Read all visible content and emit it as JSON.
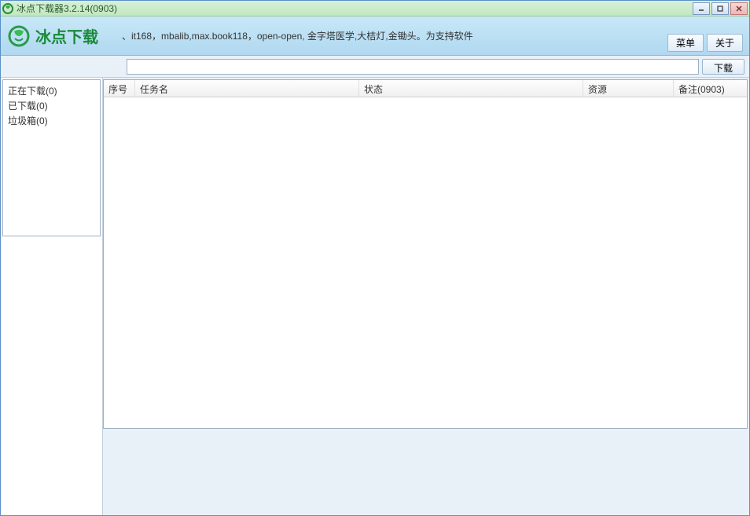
{
  "window": {
    "title": "冰点下载器3.2.14(0903)"
  },
  "header": {
    "logo_text": "冰点下载",
    "scroll_text": "、it168，mbalib,max.book118，open-open, 金字塔医学,大桔灯,金锄头。为支持软件",
    "menu_btn": "菜单",
    "about_btn": "关于"
  },
  "toolbar": {
    "url_value": "",
    "url_placeholder": "",
    "download_btn": "下载"
  },
  "sidebar": {
    "items": [
      {
        "label": "正在下载(0)"
      },
      {
        "label": "已下载(0)"
      },
      {
        "label": "垃圾箱(0)"
      }
    ]
  },
  "table": {
    "columns": {
      "index": "序号",
      "name": "任务名",
      "status": "状态",
      "resource": "资源",
      "note": "备注(0903)"
    },
    "rows": []
  }
}
